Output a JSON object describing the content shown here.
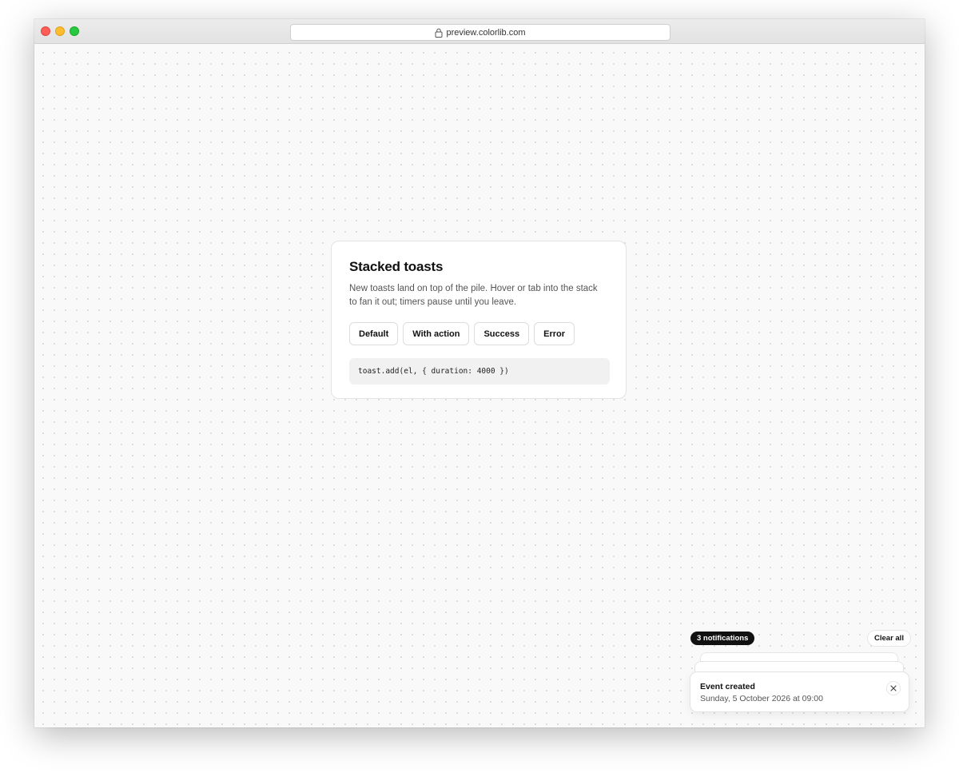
{
  "browser": {
    "url": "preview.colorlib.com"
  },
  "card": {
    "title": "Stacked toasts",
    "description": "New toasts land on top of the pile. Hover or tab into the stack to fan it out; timers pause until you leave.",
    "buttons": [
      {
        "label": "Default"
      },
      {
        "label": "With action"
      },
      {
        "label": "Success"
      },
      {
        "label": "Error"
      }
    ],
    "code": "toast.add(el, { duration: 4000 })"
  },
  "toaster": {
    "count_label": "3 notifications",
    "clear_label": "Clear all",
    "toast": {
      "title": "Event created",
      "description": "Sunday, 5 October 2026 at 09:00"
    }
  },
  "icons": {
    "lock": "lock-icon",
    "close": "close-icon"
  },
  "colors": {
    "close_dot": "#fe5f57",
    "minimize_dot": "#febc2e",
    "zoom_dot": "#28c840",
    "badge_bg": "#111111"
  }
}
